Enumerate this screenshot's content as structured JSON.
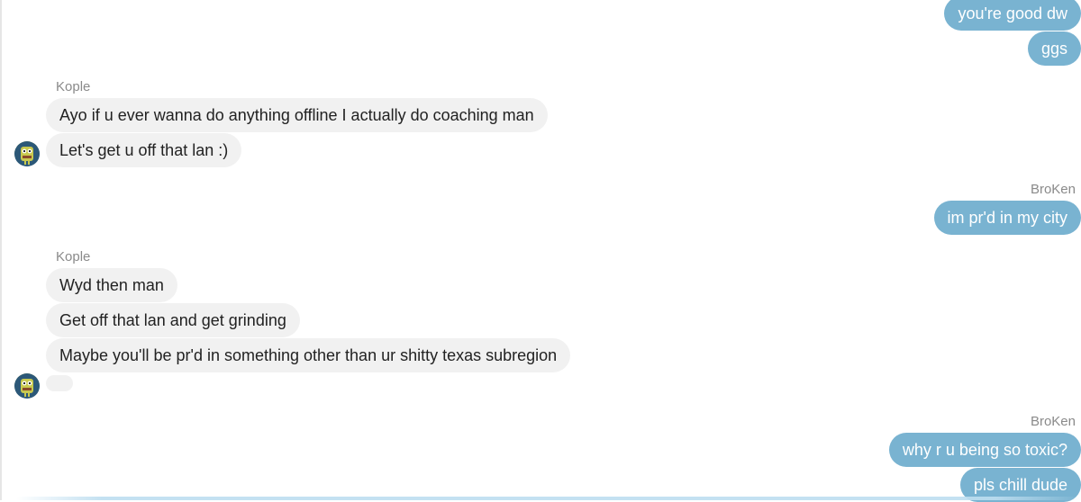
{
  "conversation": {
    "messages_top": {
      "outgoing": [
        "you're good dw",
        "ggs"
      ]
    },
    "group1": {
      "sender": "Kople",
      "messages": [
        "Ayo if u ever wanna do anything offline I actually do coaching man",
        "Let's get u off that lan :)"
      ]
    },
    "group2": {
      "sender": "BroKen",
      "messages": [
        "im pr'd in my city"
      ]
    },
    "group3": {
      "sender": "Kople",
      "messages": [
        "Wyd then man",
        "Get off that lan and get grinding",
        "Maybe you'll be pr'd in something other than ur shitty texas subregion"
      ]
    },
    "group4": {
      "sender": "BroKen",
      "messages": [
        "why r u being so toxic?",
        "pls chill dude"
      ]
    }
  },
  "colors": {
    "outgoing_bubble": "#79b3d1",
    "incoming_bubble": "#f1f1f1",
    "sender_label": "#8a8a8a"
  },
  "icons": {
    "avatar": "kople-avatar-icon"
  }
}
